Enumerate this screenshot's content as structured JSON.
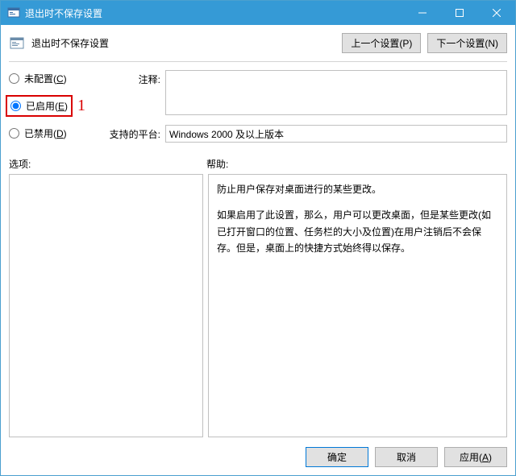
{
  "titlebar": {
    "title": "退出时不保存设置"
  },
  "header": {
    "title": "退出时不保存设置",
    "prev_btn": "上一个设置(P)",
    "next_btn": "下一个设置(N)"
  },
  "radios": {
    "not_configured": "未配置(C)",
    "enabled": "已启用(E)",
    "disabled": "已禁用(D)",
    "selected": "enabled"
  },
  "annotation": {
    "number": "1"
  },
  "fields": {
    "comment_label": "注释:",
    "comment_value": "",
    "platform_label": "支持的平台:",
    "platform_value": "Windows 2000 及以上版本"
  },
  "labels": {
    "options": "选项:",
    "help": "帮助:"
  },
  "help": {
    "p1": "防止用户保存对桌面进行的某些更改。",
    "p2": "如果启用了此设置，那么，用户可以更改桌面，但是某些更改(如已打开窗口的位置、任务栏的大小及位置)在用户注销后不会保存。但是，桌面上的快捷方式始终得以保存。"
  },
  "footer": {
    "ok": "确定",
    "cancel": "取消",
    "apply": "应用(A)"
  }
}
